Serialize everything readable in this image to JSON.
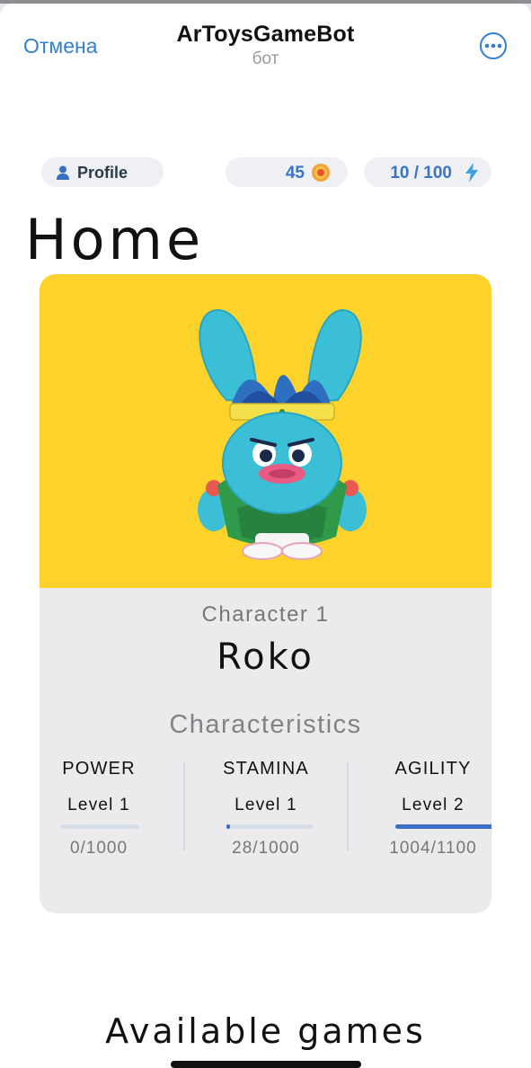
{
  "header": {
    "cancel_label": "Отмена",
    "title": "ArToysGameBot",
    "subtitle": "бот"
  },
  "status": {
    "profile_label": "Profile",
    "coins": "45",
    "energy": "10 / 100"
  },
  "page_heading": "Home",
  "character": {
    "index_label": "Character 1",
    "name": "Roko",
    "section_label": "Characteristics",
    "stats": [
      {
        "name": "POWER",
        "level": "Level 1",
        "value": "0/1000",
        "progress": 0.0
      },
      {
        "name": "STAMINA",
        "level": "Level 1",
        "value": "28/1000",
        "progress": 0.028
      },
      {
        "name": "AGILITY",
        "level": "Level 2",
        "value": "1004/1100",
        "progress": 0.913
      }
    ]
  },
  "games_heading": "Available games",
  "colors": {
    "accent": "#2f7fd3",
    "card_image_bg": "#fdd22a",
    "progress_fill": "#3d6fc4"
  },
  "icons": [
    "more-icon",
    "user-icon",
    "coin-icon",
    "lightning-icon"
  ]
}
